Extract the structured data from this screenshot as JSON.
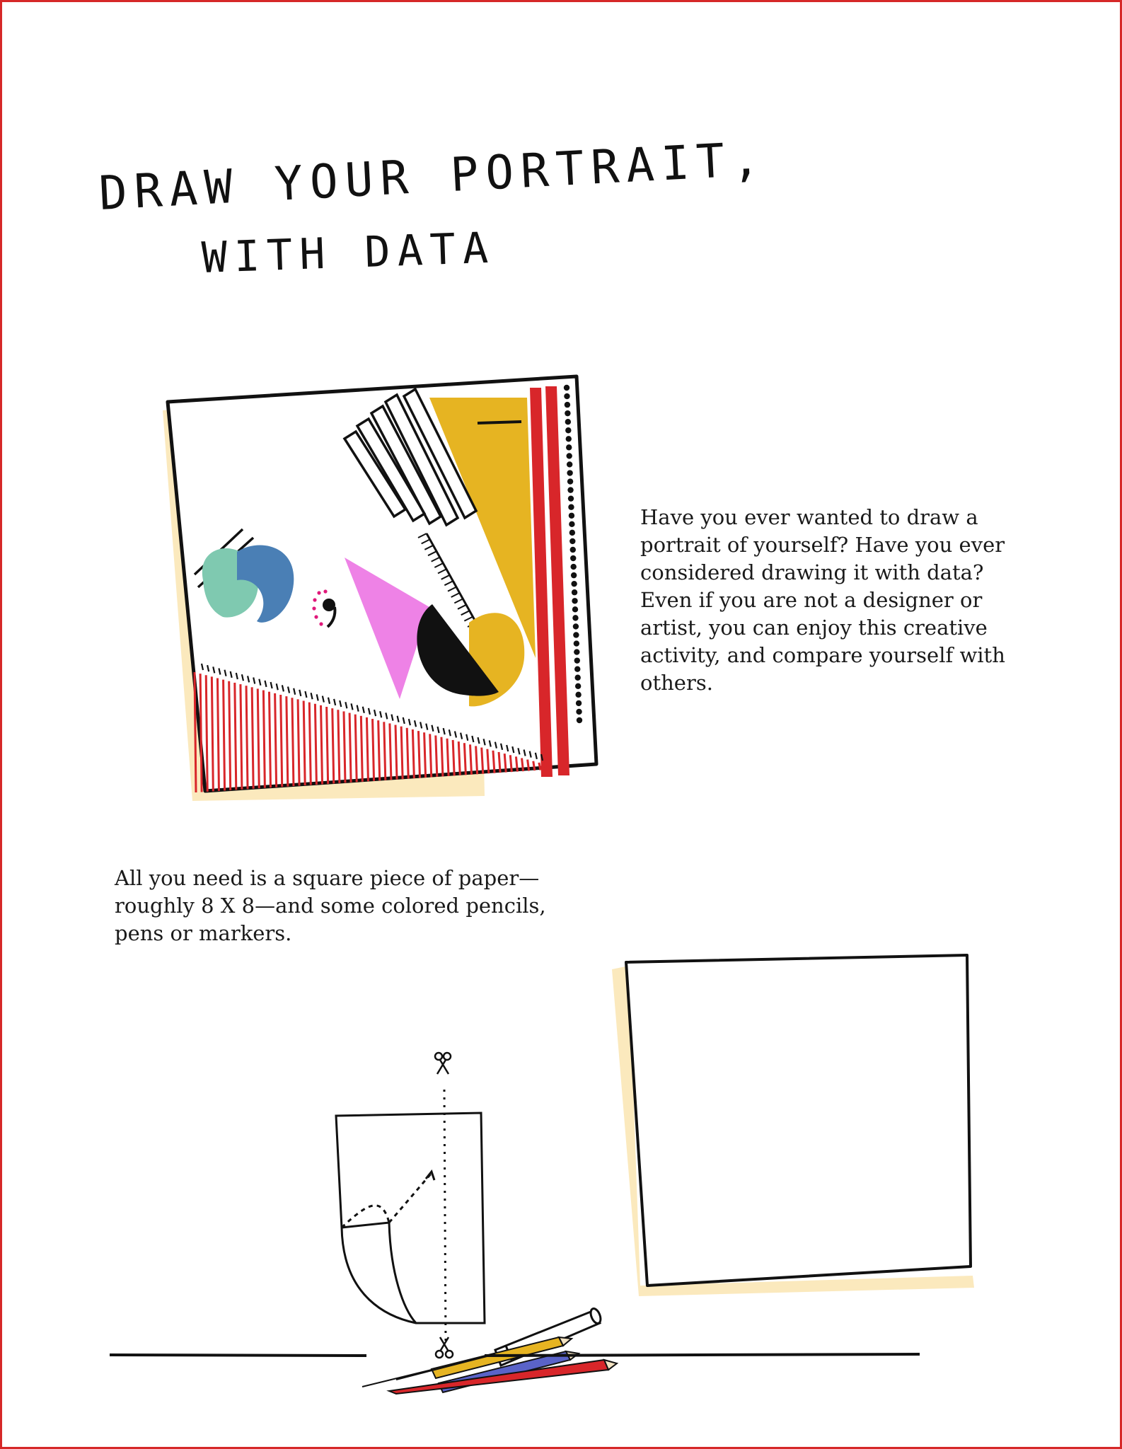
{
  "page": {
    "frame_color": "#d62828",
    "title": {
      "line1": "DRAW YOUR PORTRAIT,",
      "line2": "WITH DATA"
    },
    "intro_text": "Have you ever wanted to draw a portrait of yourself? Have you ever considered drawing it with data? Even if you are not a designer or artist, you can enjoy this creative activity, and compare yourself with others.",
    "materials_text": "All you need is a square piece of paper—roughly 8 X 8—and some colored pencils, pens or markers."
  },
  "illustrations": {
    "example_portrait": {
      "icon": "abstract-data-portrait",
      "colors": {
        "yellow": "#e6b422",
        "red": "#d8262a",
        "pink": "#ee82e6",
        "blue": "#4a7fb5",
        "teal": "#7fc9b0",
        "magenta": "#e0187a",
        "shadow": "#fbe9bd"
      }
    },
    "blank_canvas": {
      "icon": "blank-square-paper",
      "shadow_color": "#fbe9bd"
    },
    "supplies": {
      "icons": [
        "folded-paper-icon",
        "scissors-icon",
        "marker-icon",
        "colored-pencils-icon"
      ]
    }
  }
}
